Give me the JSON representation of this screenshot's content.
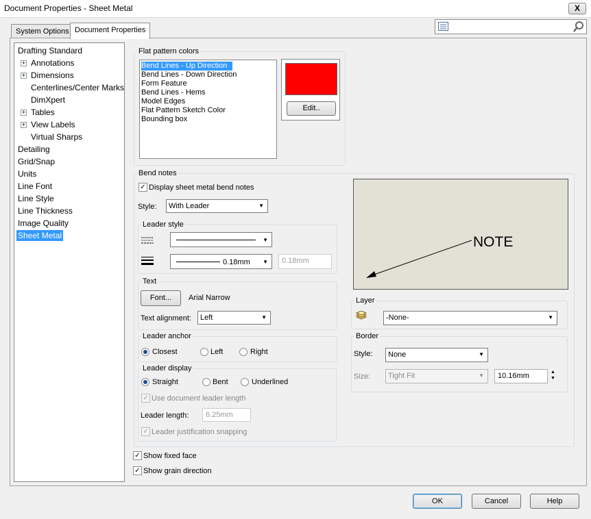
{
  "window": {
    "title": "Document Properties - Sheet Metal",
    "close": "X"
  },
  "tabs": [
    "System Options",
    "Document Properties"
  ],
  "tree": {
    "items": [
      {
        "label": "Drafting Standard"
      },
      {
        "label": "Annotations"
      },
      {
        "label": "Dimensions"
      },
      {
        "label": "Centerlines/Center Marks"
      },
      {
        "label": "DimXpert"
      },
      {
        "label": "Tables"
      },
      {
        "label": "View Labels"
      },
      {
        "label": "Virtual Sharps"
      },
      {
        "label": "Detailing"
      },
      {
        "label": "Grid/Snap"
      },
      {
        "label": "Units"
      },
      {
        "label": "Line Font"
      },
      {
        "label": "Line Style"
      },
      {
        "label": "Line Thickness"
      },
      {
        "label": "Image Quality"
      },
      {
        "label": "Sheet Metal"
      }
    ]
  },
  "flat_pattern": {
    "title": "Flat pattern colors",
    "items": [
      "Bend Lines - Up Direction",
      "Bend Lines - Down Direction",
      "Form Feature",
      "Bend Lines - Hems",
      "Model Edges",
      "Flat Pattern Sketch Color",
      "Bounding box"
    ],
    "selected_color": "#ff0000",
    "edit_button": "Edit.."
  },
  "bend_notes": {
    "title": "Bend notes",
    "display_checkbox": "Display sheet metal bend notes",
    "style_label": "Style:",
    "style_value": "With Leader",
    "leader_style": {
      "title": "Leader style",
      "thickness_value": "0.18mm",
      "thickness_custom": "0.18mm"
    },
    "text": {
      "title": "Text",
      "font_button": "Font...",
      "font_name": "Arial Narrow",
      "alignment_label": "Text alignment:",
      "alignment_value": "Left"
    },
    "leader_anchor": {
      "title": "Leader anchor",
      "options": [
        "Closest",
        "Left",
        "Right"
      ]
    },
    "leader_display": {
      "title": "Leader display",
      "options": [
        "Straight",
        "Bent",
        "Underlined"
      ],
      "use_doc_length": "Use document leader length",
      "length_label": "Leader length:",
      "length_value": "6.25mm",
      "justification": "Leader justification snapping"
    },
    "preview_text": "NOTE",
    "layer": {
      "title": "Layer",
      "value": "-None-"
    },
    "border": {
      "title": "Border",
      "style_label": "Style:",
      "style_value": "None",
      "size_label": "Size:",
      "size_value": "Tight Fit",
      "size_number": "10.16mm"
    }
  },
  "show_fixed_face": "Show fixed face",
  "show_grain_direction": "Show grain direction",
  "buttons": {
    "ok": "OK",
    "cancel": "Cancel",
    "help": "Help"
  }
}
